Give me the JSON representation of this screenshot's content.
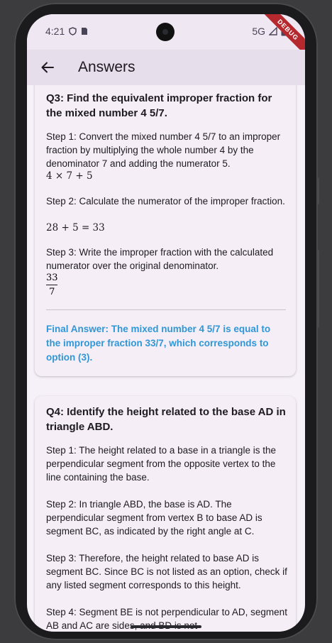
{
  "status_bar": {
    "time": "4:21",
    "network": "5G"
  },
  "debug_banner": "DEBUG",
  "app_bar": {
    "title": "Answers"
  },
  "cards": [
    {
      "question": "Q3: Find the equivalent improper fraction for the mixed number 4 5/7.",
      "steps": [
        {
          "text": "Step 1: Convert the mixed number 4 5/7 to an improper fraction by multiplying the whole number 4 by the denominator 7 and adding the numerator 5.",
          "math": "4 × 7 + 5"
        },
        {
          "text": "Step 2: Calculate the numerator of the improper fraction.",
          "math": "28 + 5 = 33"
        },
        {
          "text": "Step 3: Write the improper fraction with the calculated numerator over the original denominator.",
          "frac_num": "33",
          "frac_den": "7"
        }
      ],
      "final_answer": "Final Answer: The mixed number 4 5/7 is equal to the improper fraction 33/7, which corresponds to option (3)."
    },
    {
      "question": "Q4: Identify the height related to the base AD in triangle ABD.",
      "steps": [
        {
          "text": "Step 1: The height related to a base in a triangle is the perpendicular segment from the opposite vertex to the line containing the base."
        },
        {
          "text": "Step 2: In triangle ABD, the base is AD. The perpendicular segment from vertex B to base AD is segment BC, as indicated by the right angle at C."
        },
        {
          "text": "Step 3: Therefore, the height related to base AD is segment BC. Since BC is not listed as an option, check if any listed segment corresponds to this height."
        },
        {
          "text": "Step 4: Segment BE is not perpendicular to AD, segment AB and AC are sides, and BD is not"
        }
      ]
    }
  ]
}
